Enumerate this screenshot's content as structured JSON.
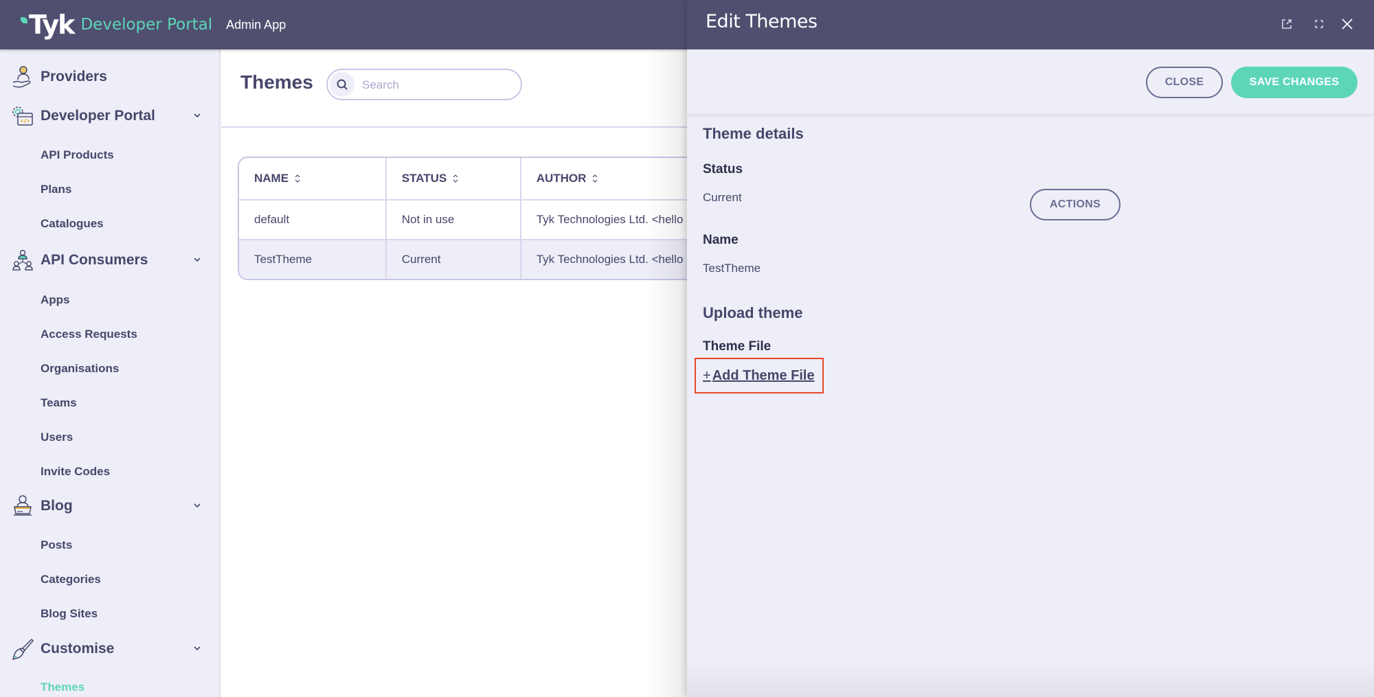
{
  "header": {
    "brand": "Tyk",
    "product": "Developer Portal",
    "app": "Admin App"
  },
  "sidebar": {
    "groups": [
      {
        "label": "Providers",
        "icon": "provider-hand-icon",
        "expandable": false
      },
      {
        "label": "Developer Portal",
        "icon": "developer-portal-icon",
        "expandable": true,
        "items": [
          "API Products",
          "Plans",
          "Catalogues"
        ]
      },
      {
        "label": "API Consumers",
        "icon": "api-consumers-icon",
        "expandable": true,
        "items": [
          "Apps",
          "Access Requests",
          "Organisations",
          "Teams",
          "Users",
          "Invite Codes"
        ]
      },
      {
        "label": "Blog",
        "icon": "blog-icon",
        "expandable": true,
        "items": [
          "Posts",
          "Categories",
          "Blog Sites"
        ]
      },
      {
        "label": "Customise",
        "icon": "paintbrush-icon",
        "expandable": true,
        "items": [
          "Themes"
        ]
      }
    ],
    "active_item": "Themes"
  },
  "main": {
    "title": "Themes",
    "search": {
      "placeholder": "Search",
      "value": ""
    },
    "table": {
      "columns": [
        "NAME",
        "STATUS",
        "AUTHOR"
      ],
      "rows": [
        {
          "name": "default",
          "status": "Not in use",
          "author": "Tyk Technologies Ltd. <hello"
        },
        {
          "name": "TestTheme",
          "status": "Current",
          "author": "Tyk Technologies Ltd. <hello"
        }
      ],
      "selected_row": 1
    }
  },
  "panel": {
    "title": "Edit Themes",
    "close_label": "CLOSE",
    "save_label": "SAVE CHANGES",
    "section_details": "Theme details",
    "status_label": "Status",
    "status_value": "Current",
    "actions_label": "ACTIONS",
    "name_label": "Name",
    "name_value": "TestTheme",
    "section_upload": "Upload theme",
    "file_label": "Theme File",
    "add_file_plus": "+",
    "add_file_label": "Add Theme File"
  },
  "colors": {
    "header_bg": "#504f70",
    "accent": "#5dd6b8",
    "text": "#47466a",
    "highlight_border": "#e8472a"
  }
}
